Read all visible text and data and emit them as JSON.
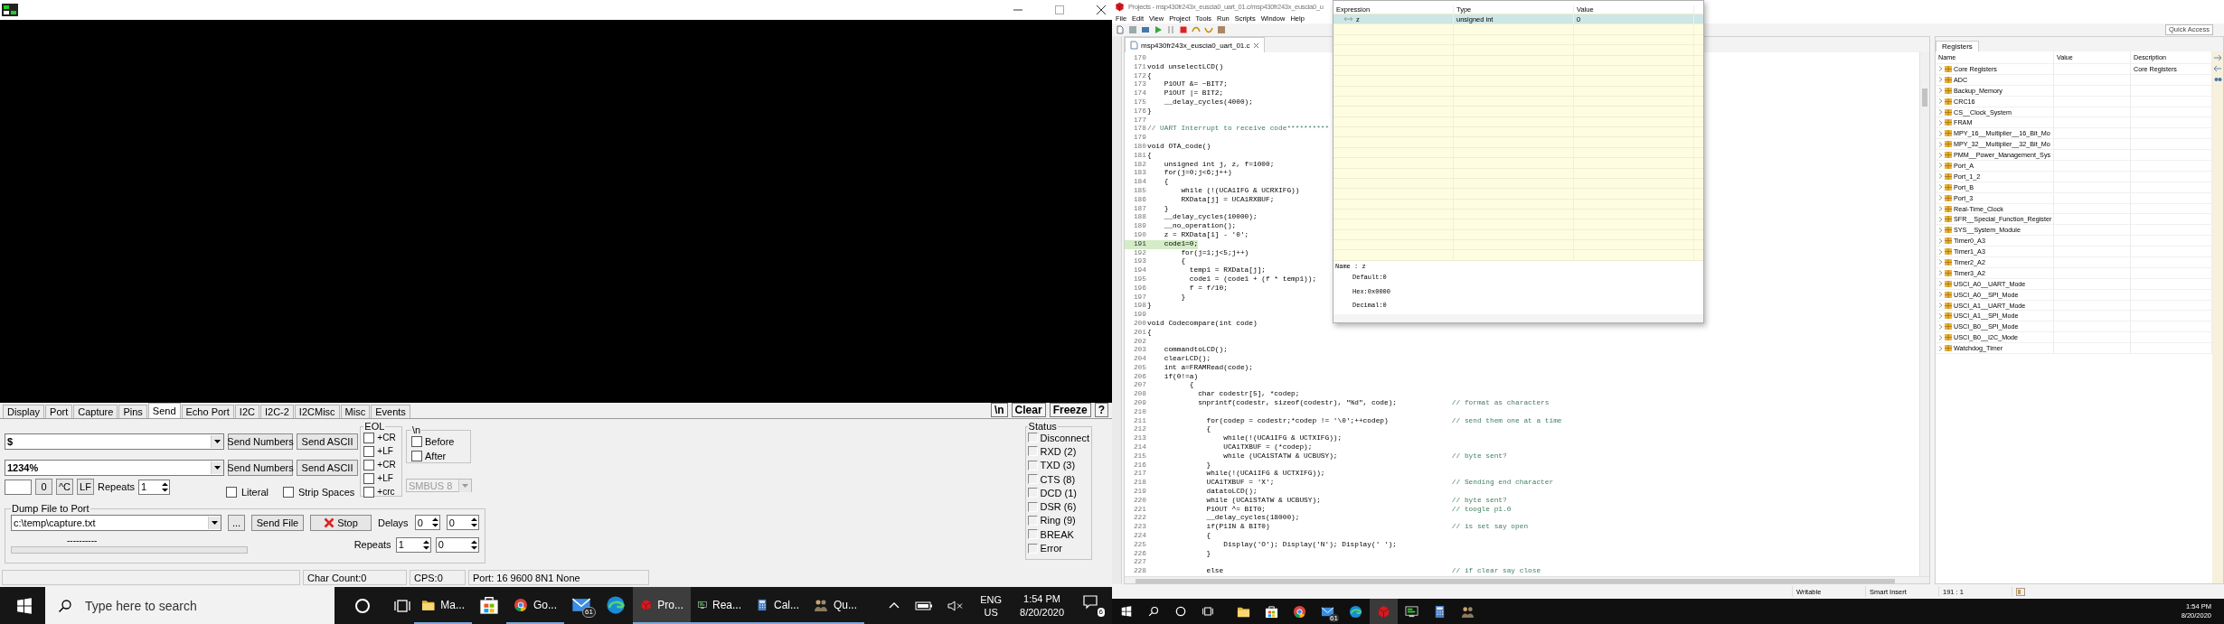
{
  "terminal": {
    "tabs": [
      {
        "label": "Display",
        "selected": false
      },
      {
        "label": "Port",
        "selected": false
      },
      {
        "label": "Capture",
        "selected": false
      },
      {
        "label": "Pins",
        "selected": false
      },
      {
        "label": "Send",
        "selected": true
      },
      {
        "label": "Echo Port",
        "selected": false
      },
      {
        "label": "I2C",
        "selected": false
      },
      {
        "label": "I2C-2",
        "selected": false
      },
      {
        "label": "I2CMisc",
        "selected": false
      },
      {
        "label": "Misc",
        "selected": false
      },
      {
        "label": "Events",
        "selected": false
      }
    ],
    "tool_buttons": [
      "\\n",
      "Clear",
      "Freeze",
      "?"
    ],
    "send_lines": [
      {
        "value": "$",
        "send_numbers": "Send Numbers",
        "send_ascii": "Send ASCII"
      },
      {
        "value": "1234%",
        "send_numbers": "Send Numbers",
        "send_ascii": "Send ASCII"
      }
    ],
    "quick_buttons": [
      "0",
      "^C",
      "LF"
    ],
    "repeats": {
      "label": "Repeats",
      "value": "1"
    },
    "options": [
      {
        "label": "Literal",
        "checked": false
      },
      {
        "label": "Strip Spaces",
        "checked": false
      }
    ],
    "eol": {
      "title": "EOL",
      "options": [
        {
          "label": "+CR",
          "checked": false
        },
        {
          "label": "+LF",
          "checked": false
        },
        {
          "label": "+CR",
          "checked": false
        },
        {
          "label": "+LF",
          "checked": false
        },
        {
          "label": "+crc",
          "checked": false
        }
      ]
    },
    "newline": {
      "title": "\\n",
      "options": [
        {
          "label": "Before",
          "checked": false
        },
        {
          "label": "After",
          "checked": false
        }
      ]
    },
    "smbus": {
      "value": "SMBUS 8",
      "disabled": true
    },
    "dump": {
      "title": "Dump File to Port",
      "file": "c:\\temp\\capture.txt",
      "browse": "...",
      "send_file": "Send File",
      "stop": "Stop",
      "delays_label": "Delays",
      "delays": [
        "0",
        "0"
      ],
      "progress_text": "----------",
      "progress": {
        "level": 0
      },
      "repeats_label": "Repeats",
      "repeats": [
        "1",
        "0"
      ]
    },
    "status": {
      "title": "Status",
      "indicators": [
        {
          "label": "Disconnect",
          "on": false
        },
        {
          "label": "RXD (2)",
          "on": false
        },
        {
          "label": "TXD (3)",
          "on": false
        },
        {
          "label": "CTS (8)",
          "on": false
        },
        {
          "label": "DCD (1)",
          "on": false
        },
        {
          "label": "DSR (6)",
          "on": false
        },
        {
          "label": "Ring (9)",
          "on": false
        },
        {
          "label": "BREAK",
          "on": false
        },
        {
          "label": "Error",
          "on": false
        }
      ]
    },
    "status_bar": [
      "Char Count:0",
      "CPS:0",
      "Port: 16 9600 8N1 None"
    ]
  },
  "taskbar_left": {
    "search_placeholder": "Type here to search",
    "apps": [
      {
        "kind": "folder",
        "label": "Ma...",
        "active": false
      },
      {
        "kind": "store",
        "active": false
      },
      {
        "kind": "chrome",
        "label": "Go...",
        "active": false
      },
      {
        "kind": "mail",
        "badge": "61",
        "active": false
      },
      {
        "kind": "edge",
        "active": false
      },
      {
        "kind": "ccs",
        "label": "Pro...",
        "active": true
      },
      {
        "kind": "terminal",
        "label": "Rea...",
        "active": false
      },
      {
        "kind": "calculator",
        "label": "Cal...",
        "active": false
      },
      {
        "kind": "people",
        "label": "Qu...",
        "active": false
      }
    ],
    "language": [
      "ENG",
      "US"
    ],
    "time": "1:54 PM",
    "date": "8/20/2020",
    "notifications": "6"
  },
  "ide": {
    "title": "Projects - msp430fr243x_euscia0_uart_01.c/msp430fr243x_euscia0_u",
    "menu": [
      "File",
      "Edit",
      "View",
      "Project",
      "Tools",
      "Run",
      "Scripts",
      "Window",
      "Help"
    ],
    "quick_access": "Quick Access",
    "editor_tab": "msp430fr243x_euscia0_uart_01.c",
    "lines": [
      {
        "n": "170",
        "current": false
      },
      {
        "n": "171",
        "code": "void unselectLCD()",
        "current": false
      },
      {
        "n": "172",
        "code": "{",
        "current": false
      },
      {
        "n": "173",
        "code": "    P1OUT &= ~BIT7;",
        "current": false
      },
      {
        "n": "174",
        "code": "    P1OUT |= BIT2;",
        "current": false
      },
      {
        "n": "175",
        "code": "    __delay_cycles(4000);",
        "current": false
      },
      {
        "n": "176",
        "code": "}",
        "current": false
      },
      {
        "n": "177",
        "current": false
      },
      {
        "n": "178",
        "comment": "// UART Interrupt to receive code**********",
        "current": false
      },
      {
        "n": "179",
        "current": false
      },
      {
        "n": "180",
        "code": "void OTA_code()",
        "current": false
      },
      {
        "n": "181",
        "code": "{",
        "current": false
      },
      {
        "n": "182",
        "code": "    unsigned int j, z, f=1000;",
        "current": false
      },
      {
        "n": "183",
        "code": "    for(j=0;j<6;j++)",
        "current": false
      },
      {
        "n": "184",
        "code": "    {",
        "current": false
      },
      {
        "n": "185",
        "code": "        while (!(UCA1IFG & UCRXIFG))",
        "current": false
      },
      {
        "n": "186",
        "code": "        RXData[j] = UCA1RXBUF;",
        "current": false
      },
      {
        "n": "187",
        "code": "    }",
        "current": false
      },
      {
        "n": "188",
        "code": "    __delay_cycles(10000);",
        "current": false
      },
      {
        "n": "189",
        "code": "    __no_operation();",
        "current": false
      },
      {
        "n": "190",
        "code": "    z = RXData[1] - '0';",
        "current": false
      },
      {
        "n": "191",
        "code": "    code1=0;",
        "current": true
      },
      {
        "n": "192",
        "code": "        for(j=1;j<5;j++)",
        "current": false
      },
      {
        "n": "193",
        "code": "        {",
        "current": false
      },
      {
        "n": "194",
        "code": "          temp1 = RXData[j];",
        "current": false
      },
      {
        "n": "195",
        "code": "          code1 = (code1 + (f * temp1));",
        "current": false
      },
      {
        "n": "196",
        "code": "          f = f/10;",
        "current": false
      },
      {
        "n": "197",
        "code": "        }",
        "current": false
      },
      {
        "n": "198",
        "code": "}",
        "current": false
      },
      {
        "n": "199",
        "current": false
      },
      {
        "n": "200",
        "code": "void Codecompare(int code)",
        "current": false
      },
      {
        "n": "201",
        "code": "{",
        "current": false
      },
      {
        "n": "202",
        "current": false
      },
      {
        "n": "203",
        "code": "    commandtoLCD();",
        "current": false
      },
      {
        "n": "204",
        "code": "    clearLCD();",
        "current": false
      },
      {
        "n": "205",
        "code": "    int a=FRAMRead(code);",
        "current": false
      },
      {
        "n": "206",
        "code": "    if(0!=a)",
        "current": false
      },
      {
        "n": "207",
        "code": "          {",
        "current": false
      },
      {
        "n": "208",
        "code": "            char codestr[5], *codep;",
        "current": false
      },
      {
        "n": "209",
        "code": "            snprintf(codestr, sizeof(codestr), \"%d\", code);",
        "comment": "// format as characters",
        "current": false
      },
      {
        "n": "210",
        "current": false
      },
      {
        "n": "211",
        "code": "              for(codep = codestr;*codep != '\\0';++codep)",
        "comment": "// send them one at a time",
        "current": false
      },
      {
        "n": "212",
        "code": "              {",
        "current": false
      },
      {
        "n": "213",
        "code": "                  while(!(UCA1IFG & UCTXIFG));",
        "current": false
      },
      {
        "n": "214",
        "code": "                  UCA1TXBUF = (*codep);",
        "current": false
      },
      {
        "n": "215",
        "code": "                  while (UCA1STATW & UCBUSY);",
        "comment": "// byte sent?",
        "current": false
      },
      {
        "n": "216",
        "code": "              }",
        "current": false
      },
      {
        "n": "217",
        "code": "              while(!(UCA1IFG & UCTXIFG));",
        "current": false
      },
      {
        "n": "218",
        "code": "              UCA1TXBUF = 'X';",
        "comment": "// Sending end character",
        "current": false
      },
      {
        "n": "219",
        "code": "              datatoLCD();",
        "current": false
      },
      {
        "n": "220",
        "code": "              while (UCA1STATW & UCBUSY);",
        "comment": "// byte sent?",
        "current": false
      },
      {
        "n": "221",
        "code": "              P1OUT ^= BIT0;",
        "comment": "// toogle p1.0",
        "current": false
      },
      {
        "n": "222",
        "code": "              __delay_cycles(18000);",
        "current": false
      },
      {
        "n": "223",
        "code": "              if(P1IN & BIT0)",
        "comment": "// is set say open",
        "current": false
      },
      {
        "n": "224",
        "code": "              {",
        "current": false
      },
      {
        "n": "225",
        "code": "                  Display('O'); Display('N'); Display(' ');",
        "current": false
      },
      {
        "n": "226",
        "code": "              }",
        "current": false
      },
      {
        "n": "227",
        "current": false
      },
      {
        "n": "228",
        "code": "              else",
        "comment": "// if clear say close",
        "current": false
      }
    ],
    "expressions": {
      "columns": [
        "Expression",
        "Type",
        "Value"
      ],
      "rows": [
        {
          "expression": "z",
          "type": "unsigned int",
          "value": "0",
          "selected": true
        }
      ],
      "details": [
        "Name : z",
        "Default:0",
        "Hex:0x0000",
        "Decimal:0"
      ]
    },
    "registers": {
      "title": "Registers",
      "columns": [
        "Name",
        "Value",
        "Description"
      ],
      "rows": [
        {
          "name": "Core Registers",
          "description": "Core Registers"
        },
        {
          "name": "ADC"
        },
        {
          "name": "Backup_Memory"
        },
        {
          "name": "CRC16"
        },
        {
          "name": "CS__Clock_System"
        },
        {
          "name": "FRAM"
        },
        {
          "name": "MPY_16__Multiplier__16_Bit_Mo"
        },
        {
          "name": "MPY_32__Multiplier__32_Bit_Mo"
        },
        {
          "name": "PMM__Power_Management_Sys"
        },
        {
          "name": "Port_A"
        },
        {
          "name": "Port_1_2"
        },
        {
          "name": "Port_B"
        },
        {
          "name": "Port_3"
        },
        {
          "name": "Real-Time_Clock"
        },
        {
          "name": "SFR__Special_Function_Register"
        },
        {
          "name": "SYS__System_Module"
        },
        {
          "name": "Timer0_A3"
        },
        {
          "name": "Timer1_A3"
        },
        {
          "name": "Timer2_A2"
        },
        {
          "name": "Timer3_A2"
        },
        {
          "name": "USCI_A0__UART_Mode"
        },
        {
          "name": "USCI_A0__SPI_Mode"
        },
        {
          "name": "USCI_A1__UART_Mode"
        },
        {
          "name": "USCI_A1__SPI_Mode"
        },
        {
          "name": "USCI_B0__SPI_Mode"
        },
        {
          "name": "USCI_B0__I2C_Mode"
        },
        {
          "name": "Watchdog_Timer"
        }
      ]
    },
    "status_bar": [
      "Writable",
      "Smart Insert",
      "191 : 1"
    ]
  },
  "taskbar_right": {
    "apps": [
      {
        "kind": "folder",
        "active": false
      },
      {
        "kind": "store",
        "active": false
      },
      {
        "kind": "chrome",
        "active": false
      },
      {
        "kind": "mail",
        "badge": "61",
        "active": false
      },
      {
        "kind": "edge",
        "active": false
      },
      {
        "kind": "ccs",
        "active": true
      },
      {
        "kind": "terminal",
        "active": false
      },
      {
        "kind": "calculator",
        "active": false
      },
      {
        "kind": "people",
        "active": false
      }
    ],
    "time": "1:54 PM",
    "date": "8/20/2020"
  }
}
